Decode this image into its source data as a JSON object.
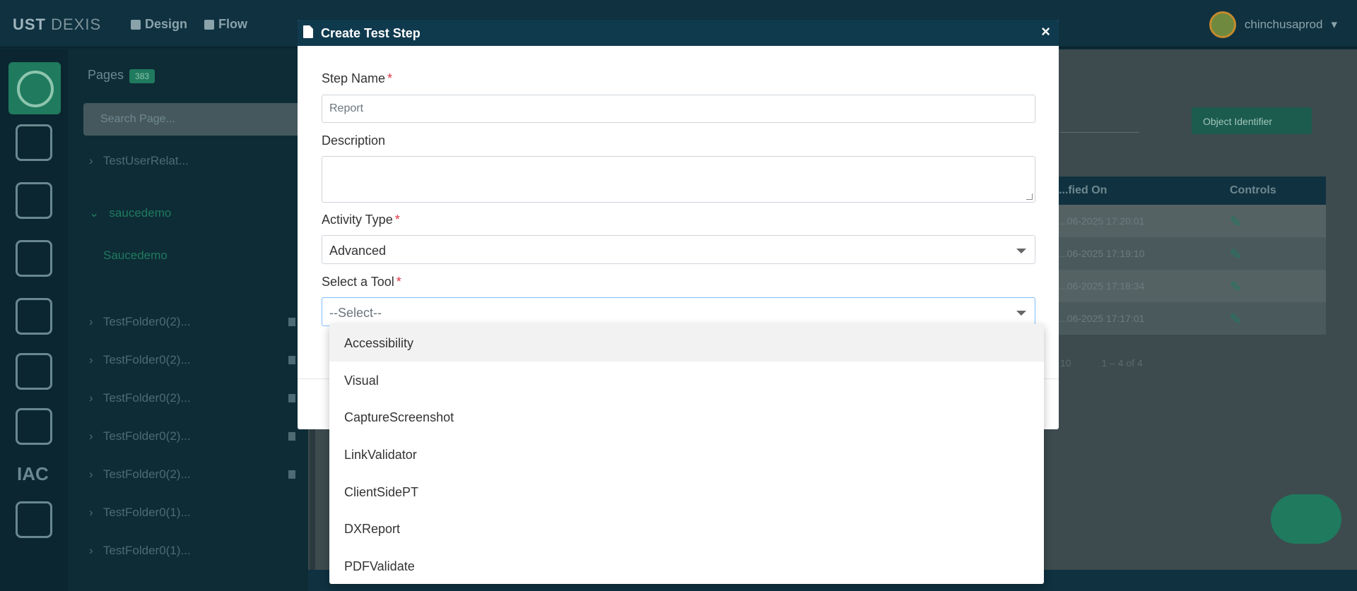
{
  "app": {
    "brand": "UST",
    "brand_light": "DEXIS",
    "nav": [
      "Design",
      "Flow"
    ],
    "user": "chinchusaprod"
  },
  "pages_panel": {
    "header": "Pages",
    "count": "383",
    "search_placeholder": "Search Page...",
    "items": [
      "TestUserRelat...",
      "saucedemo",
      "Saucedemo",
      "TestFolder0(2)...",
      "TestFolder0(2)...",
      "TestFolder0(2)...",
      "TestFolder0(2)...",
      "TestFolder0(2)...",
      "TestFolder0(1)...",
      "TestFolder0(1)..."
    ]
  },
  "rail": {
    "iac_label": "IAC"
  },
  "background_table": {
    "object_identifier_button": "Object Identifier",
    "columns": [
      "...fied On",
      "Controls"
    ],
    "rows": [
      "...06-2025 17:20:01",
      "...06-2025 17:19:10",
      "...06-2025 17:18:34",
      "...06-2025 17:17:01"
    ],
    "pager_size": "10",
    "pager_range": "1 – 4 of 4"
  },
  "modal": {
    "title": "Create Test Step",
    "close_label": "×",
    "step_name_label": "Step Name",
    "step_name_value": "Report",
    "description_label": "Description",
    "description_value": "",
    "activity_type_label": "Activity Type",
    "activity_type_value": "Advanced",
    "tool_label": "Select a Tool",
    "tool_value": "--Select--",
    "required_mark": "*"
  },
  "dropdown": {
    "options": [
      "Accessibility",
      "Visual",
      "CaptureScreenshot",
      "LinkValidator",
      "ClientSidePT",
      "DXReport",
      "PDFValidate"
    ],
    "highlighted_index": 0
  },
  "colors": {
    "header_bg": "#0f3a4e",
    "required": "#dc3545",
    "accent_green": "#1f7a5e"
  }
}
